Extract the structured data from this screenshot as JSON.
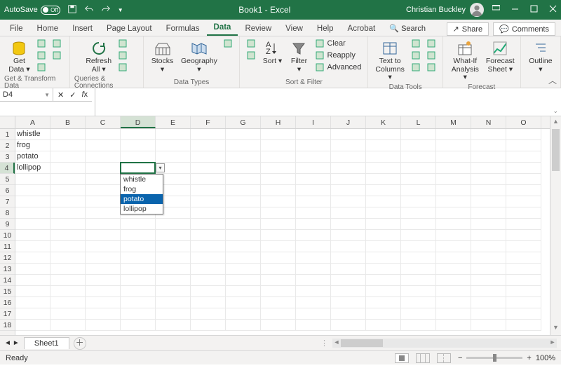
{
  "titlebar": {
    "autosave_label": "AutoSave",
    "autosave_state": "Off",
    "doc_title": "Book1 - Excel",
    "username": "Christian Buckley"
  },
  "tabs": {
    "items": [
      "File",
      "Home",
      "Insert",
      "Page Layout",
      "Formulas",
      "Data",
      "Review",
      "View",
      "Help",
      "Acrobat"
    ],
    "active": "Data",
    "search_label": "Search",
    "share_label": "Share",
    "comments_label": "Comments"
  },
  "ribbon": {
    "groups": [
      {
        "label": "Get & Transform Data",
        "items": [
          {
            "big": true,
            "name": "get-data",
            "label": "Get\nData",
            "icon": "db"
          },
          {
            "small": [
              {
                "name": "from-text",
                "icon": "txt"
              },
              {
                "name": "from-web",
                "icon": "web"
              },
              {
                "name": "from-table",
                "icon": "tbl"
              }
            ]
          },
          {
            "small": [
              {
                "name": "recent",
                "icon": "rec"
              },
              {
                "name": "existing",
                "icon": "exi"
              }
            ]
          }
        ]
      },
      {
        "label": "Queries & Connections",
        "items": [
          {
            "big": true,
            "name": "refresh-all",
            "label": "Refresh\nAll",
            "icon": "refresh"
          },
          {
            "small": [
              {
                "name": "queries",
                "icon": "q"
              },
              {
                "name": "properties",
                "icon": "p"
              },
              {
                "name": "edit-links",
                "icon": "l"
              }
            ]
          }
        ]
      },
      {
        "label": "Data Types",
        "items": [
          {
            "big": true,
            "name": "stocks",
            "label": "Stocks",
            "icon": "stocks"
          },
          {
            "big": true,
            "name": "geography",
            "label": "Geography",
            "icon": "geo"
          },
          {
            "small": [
              {
                "name": "dt-more",
                "icon": "dd"
              }
            ]
          }
        ]
      },
      {
        "label": "Sort & Filter",
        "items": [
          {
            "small": [
              {
                "name": "sort-az",
                "icon": "az"
              },
              {
                "name": "sort-za",
                "icon": "za"
              }
            ]
          },
          {
            "big": true,
            "name": "sort",
            "label": "Sort",
            "icon": "sort"
          },
          {
            "big": true,
            "name": "filter",
            "label": "Filter",
            "icon": "filter"
          },
          {
            "small": [
              {
                "name": "clear",
                "label": "Clear",
                "icon": "clr"
              },
              {
                "name": "reapply",
                "label": "Reapply",
                "icon": "re"
              },
              {
                "name": "advanced",
                "label": "Advanced",
                "icon": "adv"
              }
            ]
          }
        ]
      },
      {
        "label": "Data Tools",
        "items": [
          {
            "big": true,
            "name": "text-to-columns",
            "label": "Text to\nColumns",
            "icon": "ttc"
          },
          {
            "small": [
              {
                "name": "flash-fill",
                "icon": "ff"
              },
              {
                "name": "remove-dup",
                "icon": "rd"
              },
              {
                "name": "data-val",
                "icon": "dv"
              }
            ]
          },
          {
            "small": [
              {
                "name": "consolidate",
                "icon": "co"
              },
              {
                "name": "relationships",
                "icon": "rl"
              },
              {
                "name": "manage-dm",
                "icon": "dm"
              }
            ]
          }
        ]
      },
      {
        "label": "Forecast",
        "items": [
          {
            "big": true,
            "name": "what-if",
            "label": "What-If\nAnalysis",
            "icon": "wif"
          },
          {
            "big": true,
            "name": "forecast-sheet",
            "label": "Forecast\nSheet",
            "icon": "fc"
          }
        ]
      },
      {
        "label": "",
        "items": [
          {
            "big": true,
            "name": "outline",
            "label": "Outline",
            "icon": "out"
          }
        ]
      }
    ]
  },
  "namebox": {
    "value": "D4"
  },
  "formula_bar": {
    "value": ""
  },
  "grid": {
    "columns": [
      "A",
      "B",
      "C",
      "D",
      "E",
      "F",
      "G",
      "H",
      "I",
      "J",
      "K",
      "L",
      "M",
      "N",
      "O"
    ],
    "row_count": 18,
    "selected_cell": "D4",
    "selected_col": "D",
    "selected_row": 4,
    "data": {
      "A1": "whistle",
      "A2": "frog",
      "A3": "potato",
      "A4": "lollipop"
    },
    "dropdown": {
      "anchor": "D4",
      "options": [
        "whistle",
        "frog",
        "potato",
        "lollipop"
      ],
      "highlighted": "potato"
    }
  },
  "sheets": {
    "active": "Sheet1"
  },
  "statusbar": {
    "status": "Ready",
    "zoom": "100%"
  }
}
